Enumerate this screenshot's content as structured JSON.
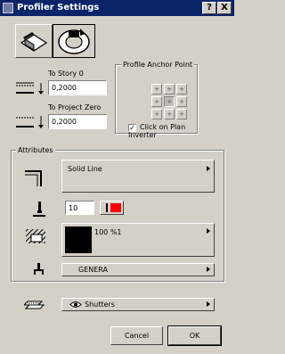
{
  "window": {
    "title": "Profiler Settings",
    "help_label": "?",
    "close_label": "X"
  },
  "elevation": {
    "to_story_label": "To Story 0",
    "to_story_value": "0,2000",
    "to_project_label": "To Project Zero",
    "to_project_value": "0,2000"
  },
  "anchor": {
    "group_label": "Profile Anchor Point",
    "grid_glyphs": [
      "+",
      "+",
      "+",
      "+",
      "+",
      "+",
      "+",
      "+",
      "+"
    ],
    "active_index": 4,
    "click_checkbox_label": "Click on Plan",
    "click_checkbox_label2": "Inverter",
    "click_checked": true
  },
  "attributes": {
    "group_label": "Attributes",
    "line_type": "Solid Line",
    "pen_number": "10",
    "pen_color": "#ff0000",
    "fill_label": "100 %1",
    "material": "GENERA"
  },
  "layer": {
    "name": "Shutters"
  },
  "footer": {
    "cancel_label": "Cancel",
    "ok_label": "OK"
  },
  "icons": [
    "profile-type-flat-icon",
    "profile-type-rotate-icon",
    "story-elevation-icon",
    "project-zero-elevation-icon",
    "line-corner-icon",
    "pen-icon",
    "hatch-fill-icon",
    "material-icon",
    "layer-icon",
    "eye-icon"
  ]
}
